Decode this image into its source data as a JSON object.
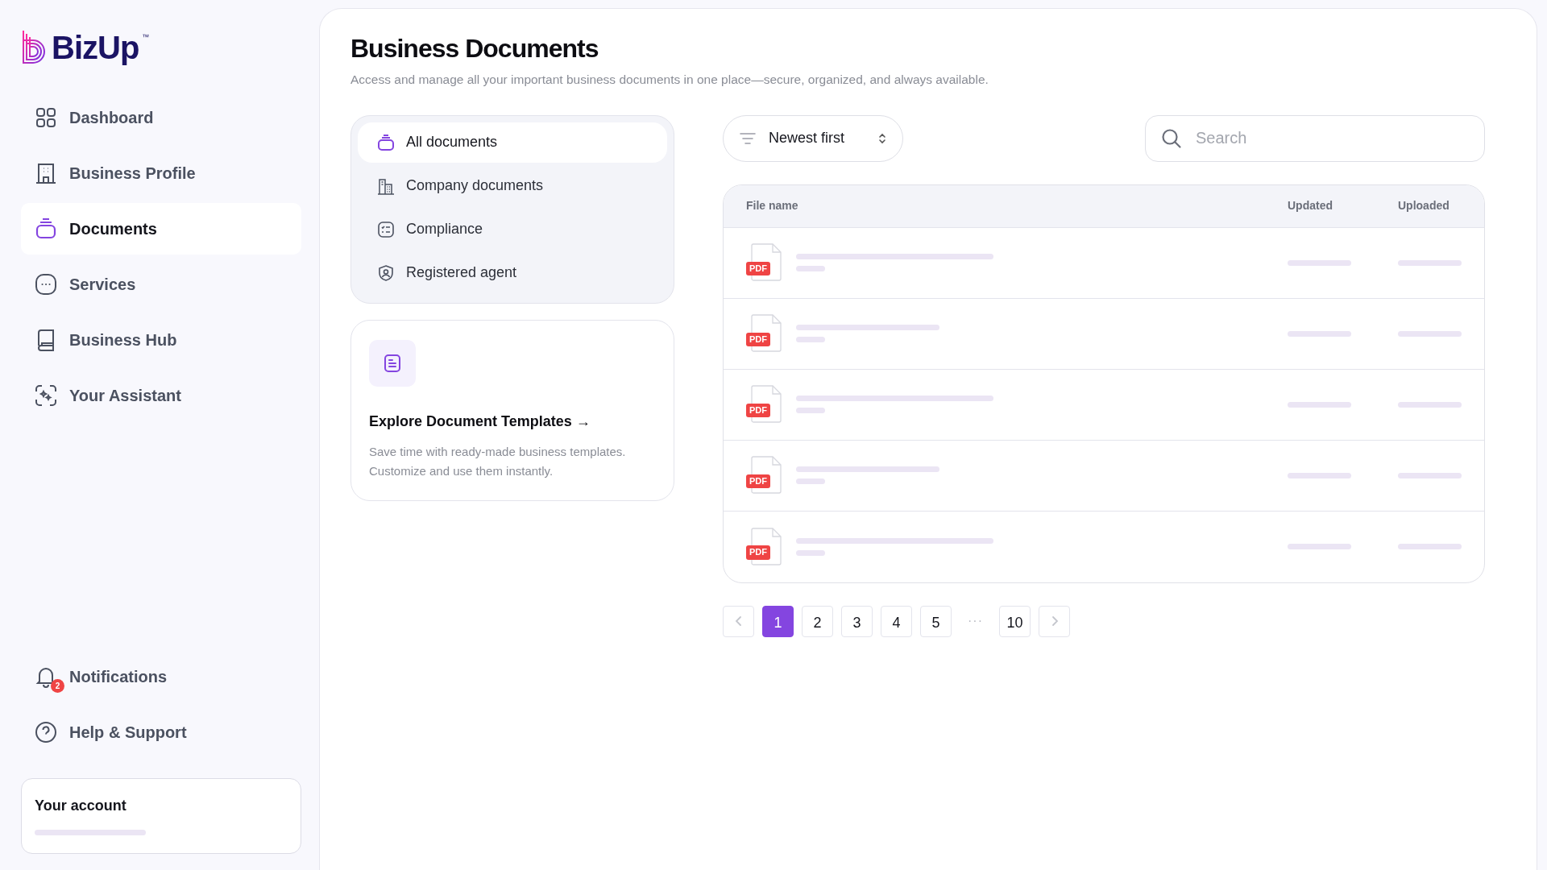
{
  "logo": {
    "text": "BizUp",
    "trademark": "™"
  },
  "sidebar": {
    "items": [
      {
        "label": "Dashboard",
        "selected": false
      },
      {
        "label": "Business Profile",
        "selected": false
      },
      {
        "label": "Documents",
        "selected": true
      },
      {
        "label": "Services",
        "selected": false
      },
      {
        "label": "Business Hub",
        "selected": false
      },
      {
        "label": "Your Assistant",
        "selected": false
      }
    ],
    "bottom_items": [
      {
        "label": "Notifications",
        "badge": "2"
      },
      {
        "label": "Help & Support"
      }
    ],
    "account": {
      "title": "Your account"
    }
  },
  "header": {
    "title": "Business Documents",
    "subtitle": "Access and manage all your important business documents in one place—secure, organized, and always available."
  },
  "categories": [
    {
      "label": "All documents",
      "selected": true
    },
    {
      "label": "Company documents",
      "selected": false
    },
    {
      "label": "Compliance",
      "selected": false
    },
    {
      "label": "Registered agent",
      "selected": false
    }
  ],
  "template_card": {
    "title": "Explore Document Templates →",
    "text": "Save time with ready-made business templates. Customize and use them instantly."
  },
  "sort": {
    "value": "Newest first"
  },
  "search": {
    "placeholder": "Search"
  },
  "table": {
    "columns": [
      "File name",
      "Updated",
      "Uploaded"
    ],
    "rows": [
      {
        "file_type": "PDF",
        "kind": "long"
      },
      {
        "file_type": "PDF",
        "kind": "short"
      },
      {
        "file_type": "PDF",
        "kind": "long"
      },
      {
        "file_type": "PDF",
        "kind": "short"
      },
      {
        "file_type": "PDF",
        "kind": "long"
      }
    ]
  },
  "pagination": {
    "pages": [
      {
        "kind": "page",
        "label": "1",
        "selected": true
      },
      {
        "kind": "page",
        "label": "2",
        "selected": false
      },
      {
        "kind": "page",
        "label": "3",
        "selected": false
      },
      {
        "kind": "page",
        "label": "4",
        "selected": false
      },
      {
        "kind": "page",
        "label": "5",
        "selected": false
      },
      {
        "kind": "gap",
        "label": "···"
      },
      {
        "kind": "page",
        "label": "10",
        "selected": false
      }
    ]
  }
}
